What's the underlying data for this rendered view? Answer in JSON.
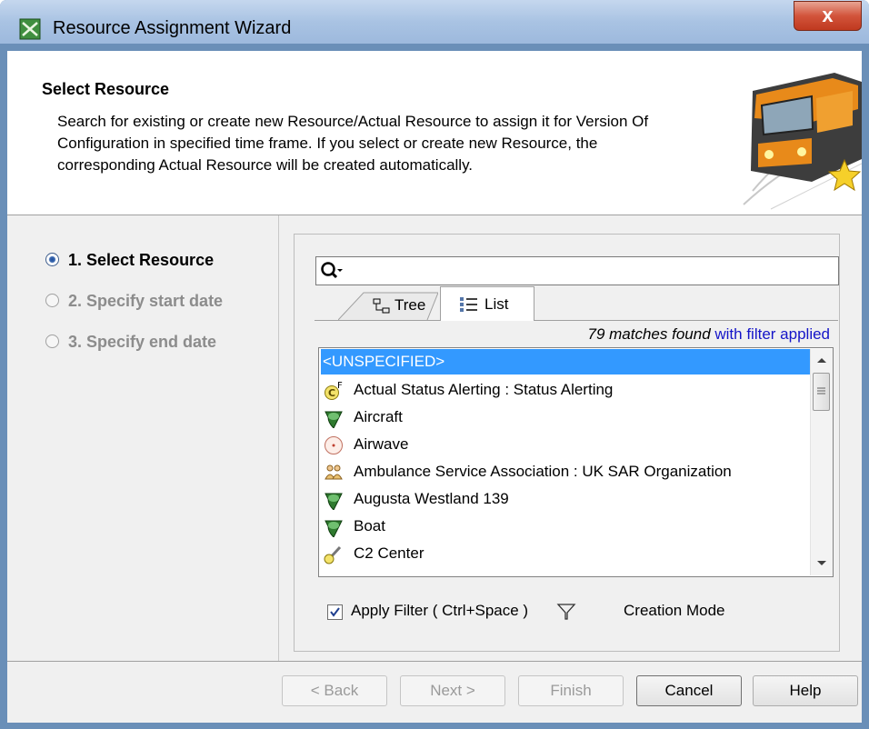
{
  "window": {
    "title": "Resource Assignment Wizard",
    "close_label": "x"
  },
  "header": {
    "title": "Select Resource",
    "description": "Search for existing or create new Resource/Actual Resource to assign it for Version Of Configuration in specified time frame. If you select or create new Resource, the corresponding Actual Resource will be created automatically."
  },
  "steps": [
    {
      "label": "1. Select Resource",
      "active": true
    },
    {
      "label": "2. Specify start date",
      "active": false
    },
    {
      "label": "3. Specify end date",
      "active": false
    }
  ],
  "search": {
    "value": ""
  },
  "tabs": [
    {
      "label": "Tree",
      "selected": false
    },
    {
      "label": "List",
      "selected": true
    }
  ],
  "matches": {
    "count_text": "79 matches found",
    "filter_text": " with filter applied"
  },
  "list": {
    "items": [
      {
        "label": "<UNSPECIFIED>",
        "icon": "none",
        "selected": true
      },
      {
        "label": "Actual Status Alerting : Status Alerting",
        "icon": "actual-function-icon",
        "selected": false
      },
      {
        "label": "Aircraft",
        "icon": "resource-artifact-icon",
        "selected": false
      },
      {
        "label": "Airwave",
        "icon": "physical-resource-icon",
        "selected": false
      },
      {
        "label": "Ambulance Service Association : UK SAR Organization",
        "icon": "actual-organization-icon",
        "selected": false
      },
      {
        "label": "Augusta Westland 139",
        "icon": "resource-artifact-icon",
        "selected": false
      },
      {
        "label": "Boat",
        "icon": "resource-artifact-icon",
        "selected": false
      },
      {
        "label": "C2 Center",
        "icon": "capability-configuration-icon",
        "selected": false
      }
    ]
  },
  "filter": {
    "checkbox_label": "Apply Filter ( Ctrl+Space )",
    "checked": true,
    "creation_mode_label": "Creation Mode"
  },
  "buttons": {
    "back": "< Back",
    "next": "Next >",
    "finish": "Finish",
    "cancel": "Cancel",
    "help": "Help"
  },
  "colors": {
    "selection": "#3399ff",
    "link": "#1414c8",
    "titlebar": "#a9c3e3",
    "close": "#c9482d"
  }
}
